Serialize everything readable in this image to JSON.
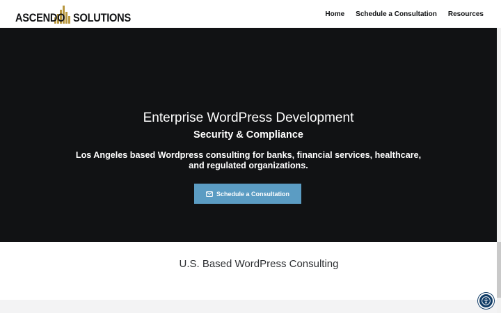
{
  "header": {
    "logo": {
      "word1": "ASCENDO",
      "word2": "SOLUTIONS",
      "bar_color": "#b8973f",
      "text_color": "#111214"
    },
    "nav": [
      {
        "label": "Home"
      },
      {
        "label": "Schedule a Consultation"
      },
      {
        "label": "Resources"
      }
    ]
  },
  "hero": {
    "background": "#111214",
    "title": "Enterprise WordPress Development",
    "subtitle": "Security & Compliance",
    "description": "Los Angeles based Wordpress consulting for banks, financial services, healthcare, and regulated organizations.",
    "cta": {
      "label": "Schedule a Consultation",
      "icon": "envelope-icon",
      "color": "#5b9cc3"
    }
  },
  "section": {
    "title": "U.S. Based WordPress Consulting"
  },
  "accessibility_button": {
    "icon": "accessibility-icon",
    "color": "#0f3b66"
  }
}
